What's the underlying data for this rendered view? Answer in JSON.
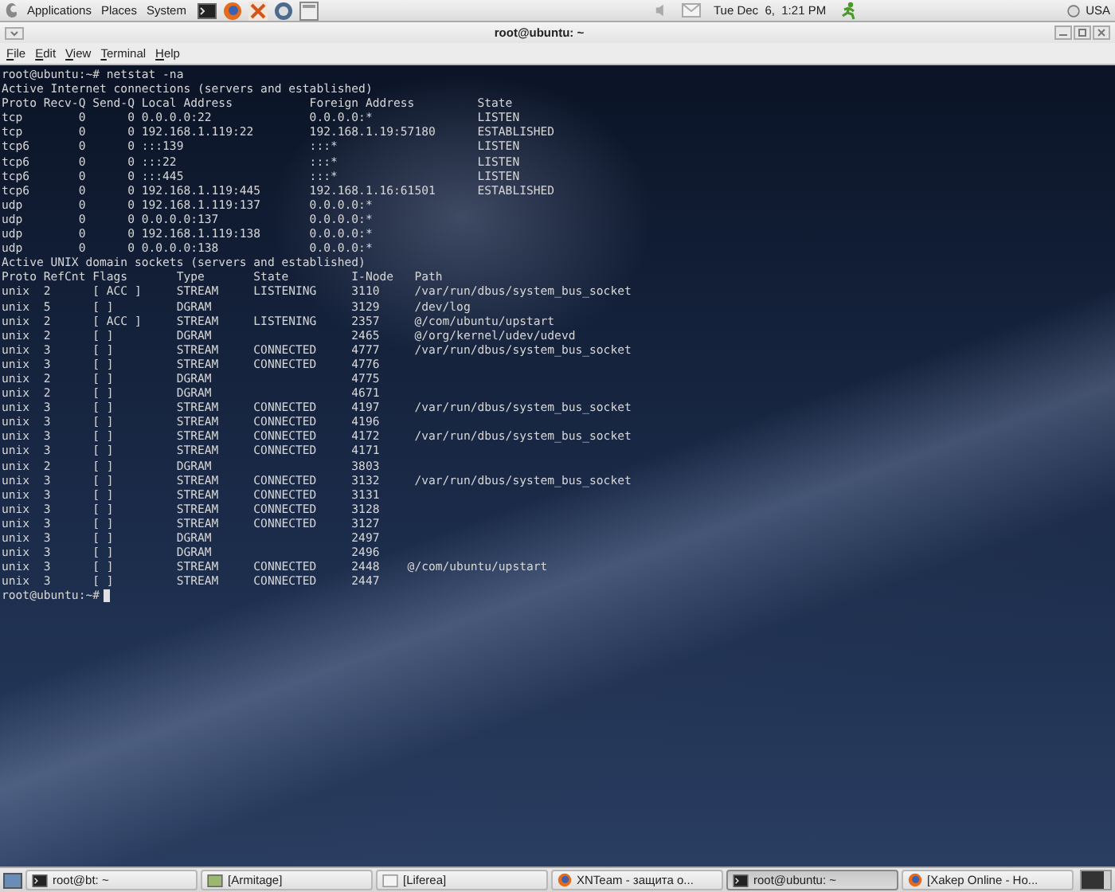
{
  "top_panel": {
    "menus": [
      "Applications",
      "Places",
      "System"
    ],
    "clock": "Tue Dec  6,  1:21 PM",
    "keyboard_layout": "USA"
  },
  "window": {
    "title": "root@ubuntu: ~",
    "menu": [
      "File",
      "Edit",
      "View",
      "Terminal",
      "Help"
    ]
  },
  "terminal": {
    "lines": [
      "root@ubuntu:~# netstat -na",
      "Active Internet connections (servers and established)",
      "Proto Recv-Q Send-Q Local Address           Foreign Address         State",
      "tcp        0      0 0.0.0.0:22              0.0.0.0:*               LISTEN",
      "tcp        0      0 192.168.1.119:22        192.168.1.19:57180      ESTABLISHED",
      "tcp6       0      0 :::139                  :::*                    LISTEN",
      "tcp6       0      0 :::22                   :::*                    LISTEN",
      "tcp6       0      0 :::445                  :::*                    LISTEN",
      "tcp6       0      0 192.168.1.119:445       192.168.1.16:61501      ESTABLISHED",
      "udp        0      0 192.168.1.119:137       0.0.0.0:*",
      "udp        0      0 0.0.0.0:137             0.0.0.0:*",
      "udp        0      0 192.168.1.119:138       0.0.0.0:*",
      "udp        0      0 0.0.0.0:138             0.0.0.0:*",
      "Active UNIX domain sockets (servers and established)",
      "Proto RefCnt Flags       Type       State         I-Node   Path",
      "unix  2      [ ACC ]     STREAM     LISTENING     3110     /var/run/dbus/system_bus_socket",
      "unix  5      [ ]         DGRAM                    3129     /dev/log",
      "unix  2      [ ACC ]     STREAM     LISTENING     2357     @/com/ubuntu/upstart",
      "unix  2      [ ]         DGRAM                    2465     @/org/kernel/udev/udevd",
      "unix  3      [ ]         STREAM     CONNECTED     4777     /var/run/dbus/system_bus_socket",
      "unix  3      [ ]         STREAM     CONNECTED     4776",
      "unix  2      [ ]         DGRAM                    4775",
      "unix  2      [ ]         DGRAM                    4671",
      "unix  3      [ ]         STREAM     CONNECTED     4197     /var/run/dbus/system_bus_socket",
      "unix  3      [ ]         STREAM     CONNECTED     4196",
      "unix  3      [ ]         STREAM     CONNECTED     4172     /var/run/dbus/system_bus_socket",
      "unix  3      [ ]         STREAM     CONNECTED     4171",
      "unix  2      [ ]         DGRAM                    3803",
      "unix  3      [ ]         STREAM     CONNECTED     3132     /var/run/dbus/system_bus_socket",
      "unix  3      [ ]         STREAM     CONNECTED     3131",
      "unix  3      [ ]         STREAM     CONNECTED     3128",
      "unix  3      [ ]         STREAM     CONNECTED     3127",
      "unix  3      [ ]         DGRAM                    2497",
      "unix  3      [ ]         DGRAM                    2496",
      "unix  3      [ ]         STREAM     CONNECTED     2448    @/com/ubuntu/upstart",
      "unix  3      [ ]         STREAM     CONNECTED     2447"
    ],
    "prompt": "root@ubuntu:~#"
  },
  "taskbar": [
    {
      "label": "root@bt: ~",
      "kind": "terminal",
      "selected": false
    },
    {
      "label": "[Armitage]",
      "kind": "app",
      "selected": false
    },
    {
      "label": "[Liferea]",
      "kind": "document",
      "selected": false
    },
    {
      "label": "XNTeam - защита о...",
      "kind": "browser",
      "selected": false
    },
    {
      "label": "root@ubuntu: ~",
      "kind": "terminal",
      "selected": true
    },
    {
      "label": "[Xakep Online - Ho...",
      "kind": "browser",
      "selected": false
    }
  ]
}
